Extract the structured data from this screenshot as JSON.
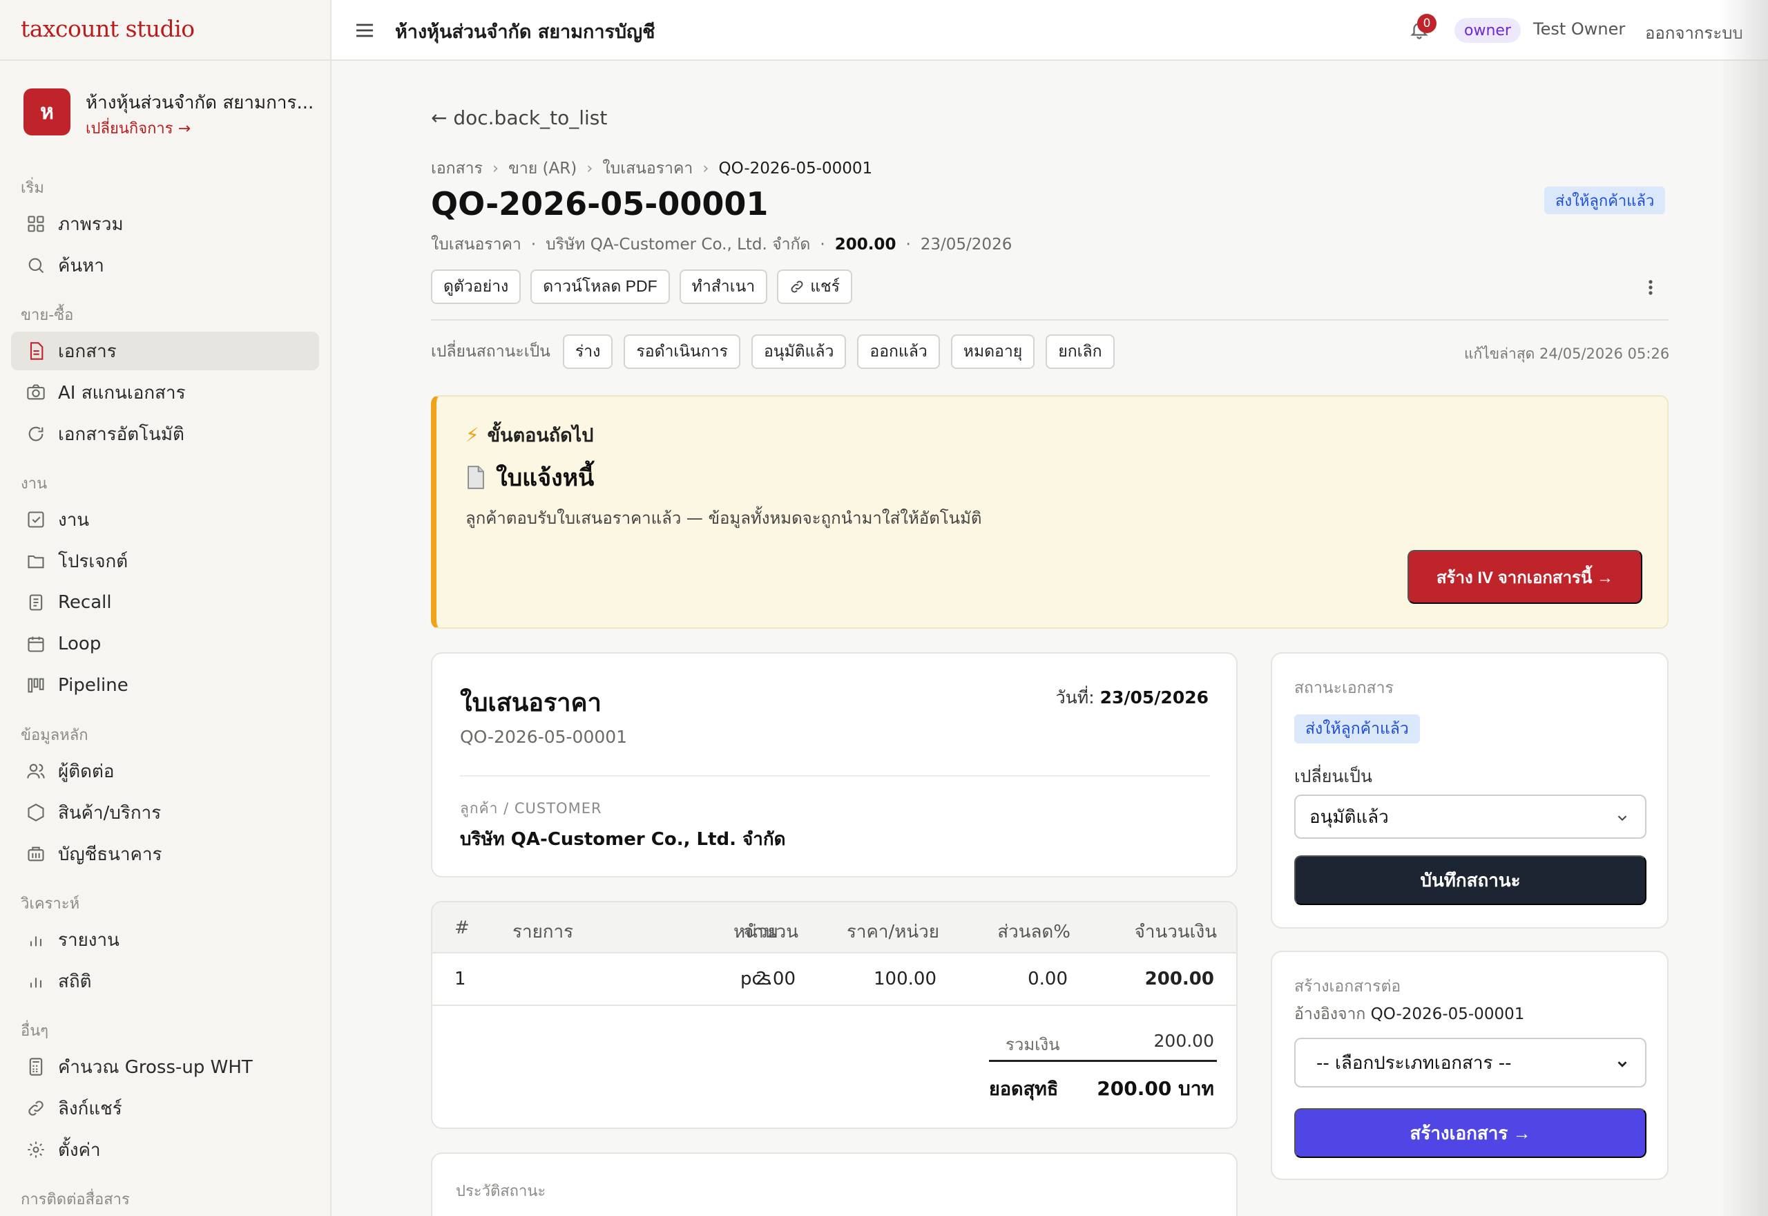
{
  "brand": "taxcount studio",
  "business": {
    "initial": "ห",
    "name": "ห้างหุ้นส่วนจำกัด สยามการ...",
    "switch_label": "เปลี่ยนกิจการ →"
  },
  "sidebar": {
    "sections": [
      {
        "label": "เริ่ม",
        "items": [
          {
            "label": "ภาพรวม",
            "icon": "grid-icon"
          },
          {
            "label": "ค้นหา",
            "icon": "search-icon"
          }
        ]
      },
      {
        "label": "ขาย-ซื้อ",
        "items": [
          {
            "label": "เอกสาร",
            "icon": "document-icon",
            "active": true
          },
          {
            "label": "AI สแกนเอกสาร",
            "icon": "camera-icon"
          },
          {
            "label": "เอกสารอัตโนมัติ",
            "icon": "refresh-icon"
          }
        ]
      },
      {
        "label": "งาน",
        "items": [
          {
            "label": "งาน",
            "icon": "checkbox-icon"
          },
          {
            "label": "โปรเจกต์",
            "icon": "folder-icon"
          },
          {
            "label": "Recall",
            "icon": "note-icon"
          },
          {
            "label": "Loop",
            "icon": "calendar-icon"
          },
          {
            "label": "Pipeline",
            "icon": "kanban-icon"
          }
        ]
      },
      {
        "label": "ข้อมูลหลัก",
        "items": [
          {
            "label": "ผู้ติดต่อ",
            "icon": "users-icon"
          },
          {
            "label": "สินค้า/บริการ",
            "icon": "box-icon"
          },
          {
            "label": "บัญชีธนาคาร",
            "icon": "bank-icon"
          }
        ]
      },
      {
        "label": "วิเคราะห์",
        "items": [
          {
            "label": "รายงาน",
            "icon": "bar-chart-icon"
          },
          {
            "label": "สถิติ",
            "icon": "bar-chart-icon"
          }
        ]
      },
      {
        "label": "อื่นๆ",
        "items": [
          {
            "label": "คำนวณ Gross-up WHT",
            "icon": "calculator-icon"
          },
          {
            "label": "ลิงก์แชร์",
            "icon": "link-icon"
          },
          {
            "label": "ตั้งค่า",
            "icon": "gear-icon"
          }
        ]
      },
      {
        "label": "การติดต่อสื่อสาร",
        "items": []
      }
    ]
  },
  "topbar": {
    "title": "ห้างหุ้นส่วนจำกัด สยามการบัญชี",
    "notif_count": "0",
    "role": "owner",
    "user": "Test Owner",
    "logout": "ออกจากระบบ"
  },
  "page": {
    "back": "← doc.back_to_list",
    "breadcrumb": [
      "เอกสาร",
      "ขาย (AR)",
      "ใบเสนอราคา",
      "QO-2026-05-00001"
    ],
    "title": "QO-2026-05-00001",
    "status": "ส่งให้ลูกค้าแล้ว",
    "meta": {
      "type": "ใบเสนอราคา",
      "customer": "บริษัท QA-Customer Co., Ltd. จำกัด",
      "amount": "200.00",
      "date": "23/05/2026"
    },
    "actions": [
      "ดูตัวอย่าง",
      "ดาวน์โหลด PDF",
      "ทำสำเนา",
      "แชร์"
    ],
    "status_change_label": "เปลี่ยนสถานะเป็น",
    "status_options": [
      "ร่าง",
      "รอดำเนินการ",
      "อนุมัติแล้ว",
      "ออกแล้ว",
      "หมดอายุ",
      "ยกเลิก"
    ],
    "last_edited": "แก้ไขล่าสุด 24/05/2026 05:26"
  },
  "next_step": {
    "heading": "ขั้นตอนถัดไป",
    "doc_type": "ใบแจ้งหนี้",
    "description": "ลูกค้าตอบรับใบเสนอราคาแล้ว — ข้อมูลทั้งหมดจะถูกนำมาใส่ให้อัตโนมัติ",
    "button": "สร้าง IV จากเอกสารนี้ →"
  },
  "document": {
    "title": "ใบเสนอราคา",
    "number": "QO-2026-05-00001",
    "date_label": "วันที่:",
    "date": "23/05/2026",
    "customer_label": "ลูกค้า / CUSTOMER",
    "customer": "บริษัท QA-Customer Co., Ltd. จำกัด"
  },
  "items_table": {
    "headers": [
      "#",
      "รายการ",
      "จำนวน",
      "หน่วย",
      "ราคา/หน่วย",
      "ส่วนลด%",
      "จำนวนเงิน"
    ],
    "rows": [
      {
        "no": "1",
        "item": "",
        "qty": "2.00",
        "unit": "pcs",
        "price": "100.00",
        "discount": "0.00",
        "amount": "200.00"
      }
    ],
    "subtotal_label": "รวมเงิน",
    "subtotal": "200.00",
    "net_label": "ยอดสุทธิ",
    "net": "200.00 บาท"
  },
  "history_label": "ประวัติสถานะ",
  "status_card": {
    "label": "สถานะเอกสาร",
    "current": "ส่งให้ลูกค้าแล้ว",
    "change_label": "เปลี่ยนเป็น",
    "selected": "อนุมัติแล้ว",
    "save": "บันทึกสถานะ"
  },
  "next_doc_card": {
    "label": "สร้างเอกสารต่อ",
    "ref_label": "อ้างอิงจาก",
    "ref": "QO-2026-05-00001",
    "select_placeholder": "-- เลือกประเภทเอกสาร --",
    "button": "สร้างเอกสาร →"
  },
  "colors": {
    "brand": "#b91c1c",
    "primary_dark": "#1e2532",
    "indigo": "#4f46e5",
    "status_blue": "#1d4ed8",
    "warning": "#f0a21a"
  }
}
